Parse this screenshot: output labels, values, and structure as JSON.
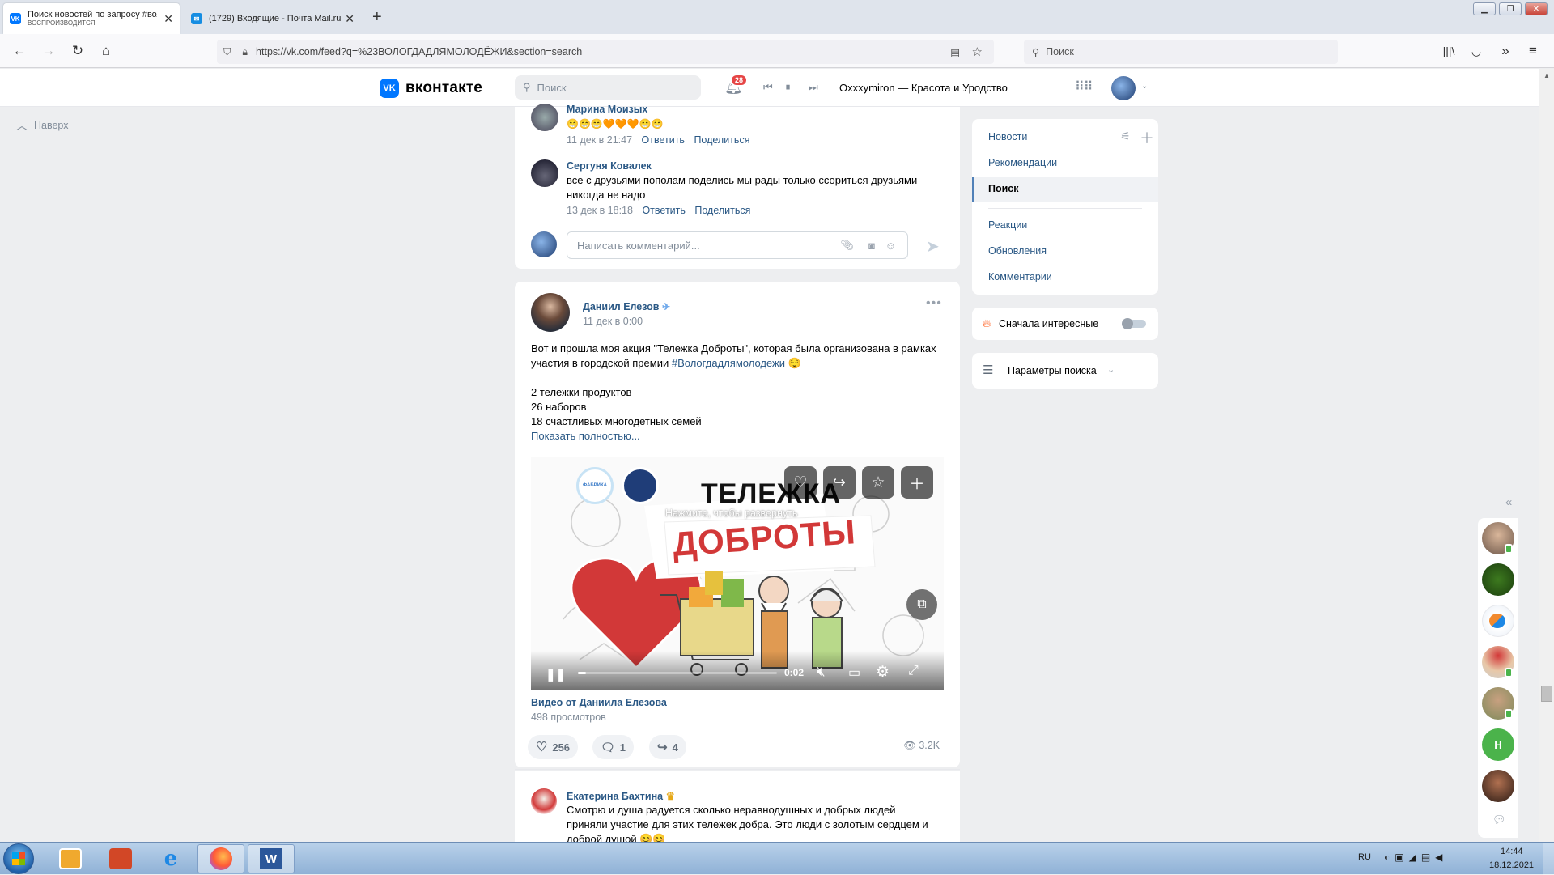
{
  "browser": {
    "tabs": [
      {
        "title": "Поиск новостей по запросу #волог...",
        "subtitle": "ВОСПРОИЗВОДИТСЯ",
        "favicon": "VK",
        "active": true
      },
      {
        "title": "(1729) Входящие - Почта Mail.ru",
        "favicon": "✉",
        "active": false
      }
    ],
    "new_tab": "+",
    "url": "https://vk.com/feed?q=%23ВОЛОГДАДЛЯМОЛОДЁЖИ&section=search",
    "search_placeholder": "Поиск"
  },
  "vk": {
    "logo_text": "вконтакте",
    "search_placeholder": "Поиск",
    "notifications_count": "28",
    "now_playing": "Oxxxymiron — Красота и Уродство",
    "back_to_top": "Наверх"
  },
  "comments_top": [
    {
      "name": "Марина Моизых",
      "text": "😁😁😁🧡🧡🧡😁😁",
      "time": "11 дек в 21:47",
      "reply": "Ответить",
      "share": "Поделиться"
    },
    {
      "name": "Сергуня Ковалек",
      "text": "все с друзьями пополам поделись мы рады только ссориться друзьями никогда не надо",
      "time": "13 дек в 18:18",
      "reply": "Ответить",
      "share": "Поделиться"
    }
  ],
  "comment_input_placeholder": "Написать комментарий...",
  "post": {
    "author": "Даниил Елезов",
    "date": "11 дек в 0:00",
    "text_line1": "Вот и прошла моя акция \"Тележка Доброты\", которая была организована в рамках",
    "text_line2": "участия в городской премии ",
    "hashtag": "#Вологдадлямолодежи",
    "list": [
      "2 тележки продуктов",
      "26 наборов",
      "18 счастливых многодетных семей"
    ],
    "show_more": "Показать полностью...",
    "video": {
      "title_top": "ТЕЛЕЖКА",
      "title_bottom": "ДОБРОТЫ",
      "hint": "Нажмите, чтобы развернуть",
      "logo1": "ФАБРИКА",
      "time": "0:02",
      "caption": "Видео от Даниила Елезова",
      "views": "498 просмотров",
      "progress": 0.04
    },
    "likes": "256",
    "comments": "1",
    "shares": "4",
    "views": "3.2K"
  },
  "comment_bottom": {
    "name": "Екатерина Бахтина",
    "line1": "Смотрю и душа радуется сколько неравнодушных и добрых людей",
    "line2": "приняли участие для этих тележек добра. Это люди с золотым сердцем и",
    "line3": "доброй душой 😊😊"
  },
  "right_menu": {
    "items": [
      "Новости",
      "Рекомендации",
      "Поиск",
      "Реакции",
      "Обновления",
      "Комментарии"
    ],
    "selected": "Поиск",
    "interesting_first": "Сначала интересные",
    "search_params": "Параметры поиска"
  },
  "chat": {
    "letter_avatar": "Н"
  },
  "taskbar": {
    "lang": "RU",
    "time": "14:44",
    "date": "18.12.2021"
  },
  "colors": {
    "vk_blue": "#0077ff",
    "link": "#2a5885",
    "meta": "#818c99",
    "bg": "#edeef0"
  }
}
